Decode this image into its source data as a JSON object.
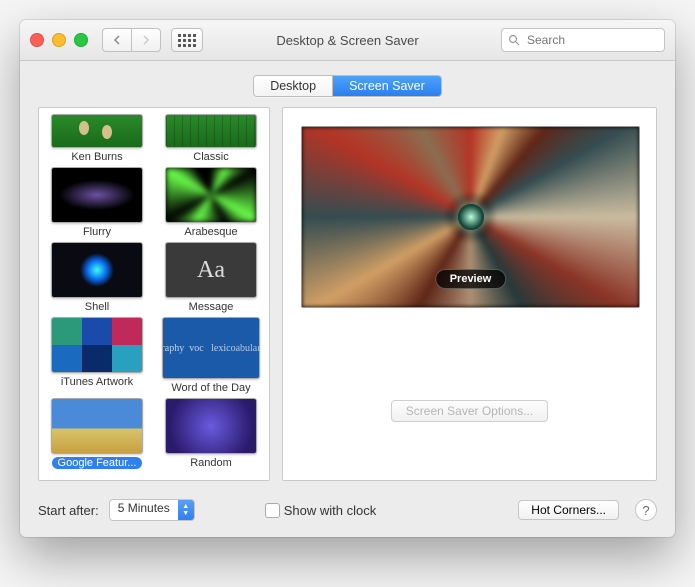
{
  "window": {
    "title": "Desktop & Screen Saver",
    "search_placeholder": "Search"
  },
  "tabs": {
    "desktop": "Desktop",
    "screensaver": "Screen Saver"
  },
  "savers": [
    {
      "name": "Ken Burns"
    },
    {
      "name": "Classic"
    },
    {
      "name": "Flurry"
    },
    {
      "name": "Arabesque"
    },
    {
      "name": "Shell"
    },
    {
      "name": "Message"
    },
    {
      "name": "iTunes Artwork"
    },
    {
      "name": "Word of the Day"
    },
    {
      "name": "Google Featur...",
      "selected": true
    },
    {
      "name": "Random"
    }
  ],
  "preview": {
    "badge": "Preview"
  },
  "options_button": "Screen Saver Options...",
  "footer": {
    "start_label": "Start after:",
    "start_value": "5 Minutes",
    "show_clock": "Show with clock",
    "hot_corners": "Hot Corners...",
    "help": "?"
  }
}
